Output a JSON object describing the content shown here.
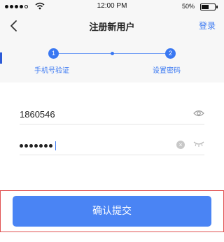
{
  "status_bar": {
    "time": "12:00 PM",
    "battery": "50%"
  },
  "nav": {
    "title": "注册新用户",
    "login_link": "登录"
  },
  "steps": [
    {
      "number": "1",
      "label": "手机号验证"
    },
    {
      "number": "2",
      "label": "设置密码"
    }
  ],
  "form": {
    "phone_value": "1860546",
    "password_dots": 7
  },
  "submit": {
    "label": "确认提交"
  },
  "colors": {
    "accent": "#3a78f2",
    "button": "#4a84f4",
    "highlight": "#e05050"
  },
  "icons": [
    "back-arrow-icon",
    "wifi-icon",
    "battery-icon",
    "eye-icon",
    "clear-icon",
    "eye-closed-icon"
  ]
}
